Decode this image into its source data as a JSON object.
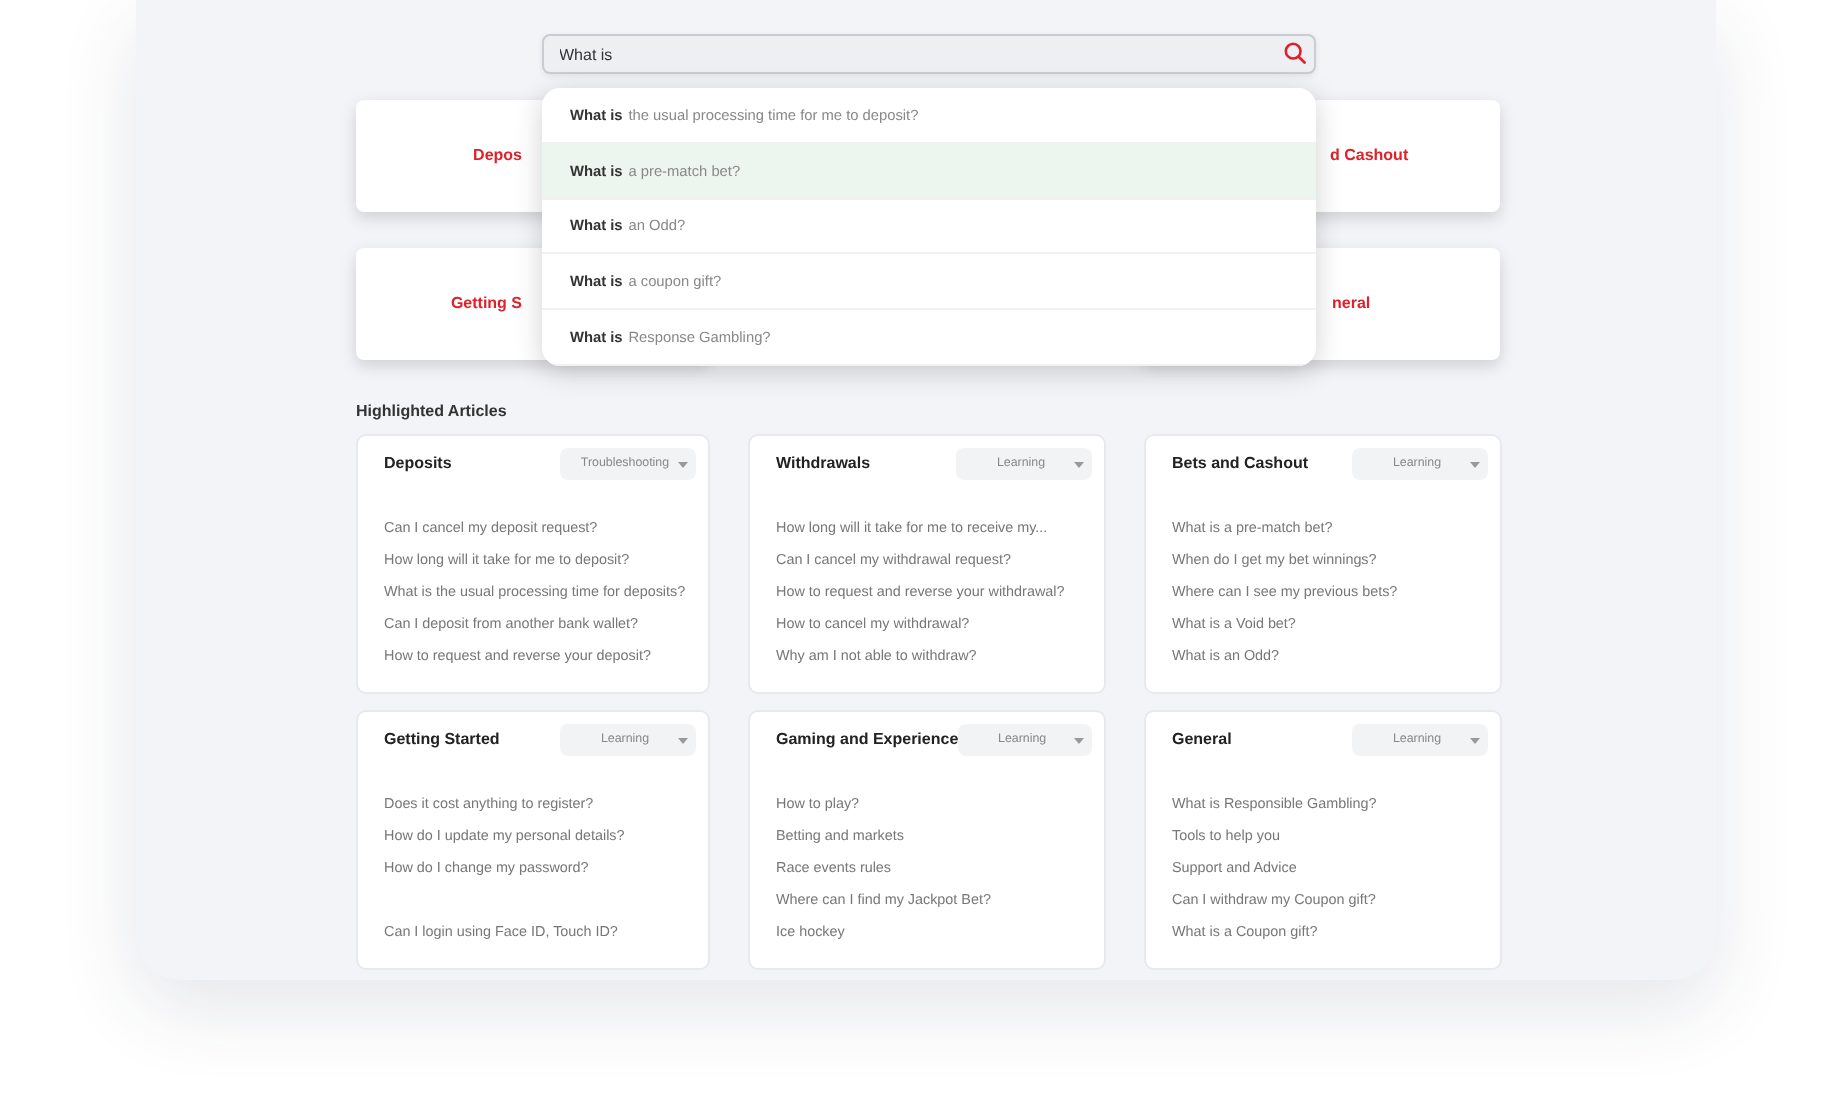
{
  "search": {
    "value": "What is"
  },
  "suggestions": [
    {
      "text": "**What is** the usual processing time for me to deposit?",
      "selected": false
    },
    {
      "text": "**What is** a pre-match bet?",
      "selected": true
    },
    {
      "text": "**What is** an Odd?",
      "selected": false
    },
    {
      "text": "**What is** a coupon gift?",
      "selected": false
    },
    {
      "text": "**What is** Response Gambling?",
      "selected": false
    }
  ],
  "category_tiles": [
    {
      "label": "Depos"
    },
    {
      "label": "d Cashout"
    },
    {
      "label": "Getting S"
    },
    {
      "label": "neral"
    }
  ],
  "section_title": "Highlighted Articles",
  "cards": [
    {
      "title": "Deposits",
      "filter": "Troubleshooting",
      "links": [
        {
          "text": "Can I cancel my deposit request?"
        },
        {
          "text": "How long will it take for me to deposit?"
        },
        {
          "text": "What is the usual processing time for deposits?"
        },
        {
          "text": "Can I deposit from another bank wallet?"
        },
        {
          "text": "How to request and reverse your deposit?"
        }
      ]
    },
    {
      "title": "Withdrawals",
      "filter": "Learning",
      "links": [
        {
          "text": "How long will it take for me to receive my..."
        },
        {
          "text": "Can I cancel my withdrawal request?"
        },
        {
          "text": "How to request and reverse your withdrawal?"
        },
        {
          "text": "How to cancel my withdrawal?"
        },
        {
          "text": "Why am I not able to withdraw?"
        }
      ]
    },
    {
      "title": "Bets and Cashout",
      "filter": "Learning",
      "links": [
        {
          "text": "What is a pre-match bet?"
        },
        {
          "text": "When do I get my bet winnings?"
        },
        {
          "text": "Where can I see my previous bets?"
        },
        {
          "text": "What is a Void bet?"
        },
        {
          "text": "What is an Odd?"
        }
      ]
    },
    {
      "title": "Getting Started",
      "filter": "Learning",
      "links": [
        {
          "text": "Does it cost anything to register?"
        },
        {
          "text": "How do I update my personal details?"
        },
        {
          "text": "How do I change my password?"
        },
        {
          "text": "Can I login using Face ID, Touch ID?",
          "gap_before": true
        }
      ]
    },
    {
      "title": "Gaming and Experience",
      "filter": "Learning",
      "links": [
        {
          "text": "How to play?"
        },
        {
          "text": "Betting and markets"
        },
        {
          "text": "Race events rules"
        },
        {
          "text": "Where can I find my Jackpot Bet?"
        },
        {
          "text": "Ice hockey"
        }
      ]
    },
    {
      "title": "General",
      "filter": "Learning",
      "links": [
        {
          "text": "What is Responsible Gambling?"
        },
        {
          "text": "Tools to help you"
        },
        {
          "text": "Support and Advice"
        },
        {
          "text": "Can I withdraw my Coupon gift?"
        },
        {
          "text": "What is a Coupon gift?"
        }
      ]
    }
  ]
}
